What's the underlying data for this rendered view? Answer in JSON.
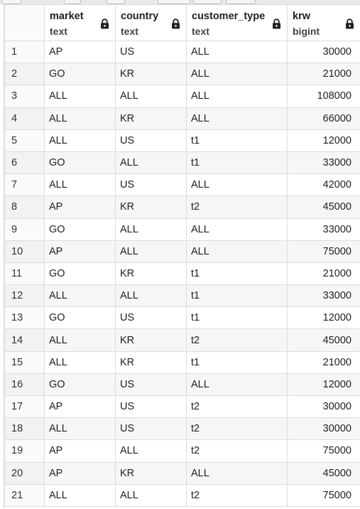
{
  "columns": [
    {
      "name": "market",
      "type": "text"
    },
    {
      "name": "country",
      "type": "text"
    },
    {
      "name": "customer_type",
      "type": "text"
    },
    {
      "name": "krw",
      "type": "bigint"
    }
  ],
  "rows": [
    {
      "n": "1",
      "market": "AP",
      "country": "US",
      "customer_type": "ALL",
      "krw": "30000"
    },
    {
      "n": "2",
      "market": "GO",
      "country": "KR",
      "customer_type": "ALL",
      "krw": "21000"
    },
    {
      "n": "3",
      "market": "ALL",
      "country": "ALL",
      "customer_type": "ALL",
      "krw": "108000"
    },
    {
      "n": "4",
      "market": "ALL",
      "country": "KR",
      "customer_type": "ALL",
      "krw": "66000"
    },
    {
      "n": "5",
      "market": "ALL",
      "country": "US",
      "customer_type": "t1",
      "krw": "12000"
    },
    {
      "n": "6",
      "market": "GO",
      "country": "ALL",
      "customer_type": "t1",
      "krw": "33000"
    },
    {
      "n": "7",
      "market": "ALL",
      "country": "US",
      "customer_type": "ALL",
      "krw": "42000"
    },
    {
      "n": "8",
      "market": "AP",
      "country": "KR",
      "customer_type": "t2",
      "krw": "45000"
    },
    {
      "n": "9",
      "market": "GO",
      "country": "ALL",
      "customer_type": "ALL",
      "krw": "33000"
    },
    {
      "n": "10",
      "market": "AP",
      "country": "ALL",
      "customer_type": "ALL",
      "krw": "75000"
    },
    {
      "n": "11",
      "market": "GO",
      "country": "KR",
      "customer_type": "t1",
      "krw": "21000"
    },
    {
      "n": "12",
      "market": "ALL",
      "country": "ALL",
      "customer_type": "t1",
      "krw": "33000"
    },
    {
      "n": "13",
      "market": "GO",
      "country": "US",
      "customer_type": "t1",
      "krw": "12000"
    },
    {
      "n": "14",
      "market": "ALL",
      "country": "KR",
      "customer_type": "t2",
      "krw": "45000"
    },
    {
      "n": "15",
      "market": "ALL",
      "country": "KR",
      "customer_type": "t1",
      "krw": "21000"
    },
    {
      "n": "16",
      "market": "GO",
      "country": "US",
      "customer_type": "ALL",
      "krw": "12000"
    },
    {
      "n": "17",
      "market": "AP",
      "country": "US",
      "customer_type": "t2",
      "krw": "30000"
    },
    {
      "n": "18",
      "market": "ALL",
      "country": "US",
      "customer_type": "t2",
      "krw": "30000"
    },
    {
      "n": "19",
      "market": "AP",
      "country": "ALL",
      "customer_type": "t2",
      "krw": "75000"
    },
    {
      "n": "20",
      "market": "AP",
      "country": "KR",
      "customer_type": "ALL",
      "krw": "45000"
    },
    {
      "n": "21",
      "market": "ALL",
      "country": "ALL",
      "customer_type": "t2",
      "krw": "75000"
    }
  ],
  "colors": {
    "border": "#dcdcdc",
    "header_bg": "#ffffff",
    "alt_row": "#f6f6f6"
  },
  "icons": {
    "column_lock": "lock-icon"
  }
}
